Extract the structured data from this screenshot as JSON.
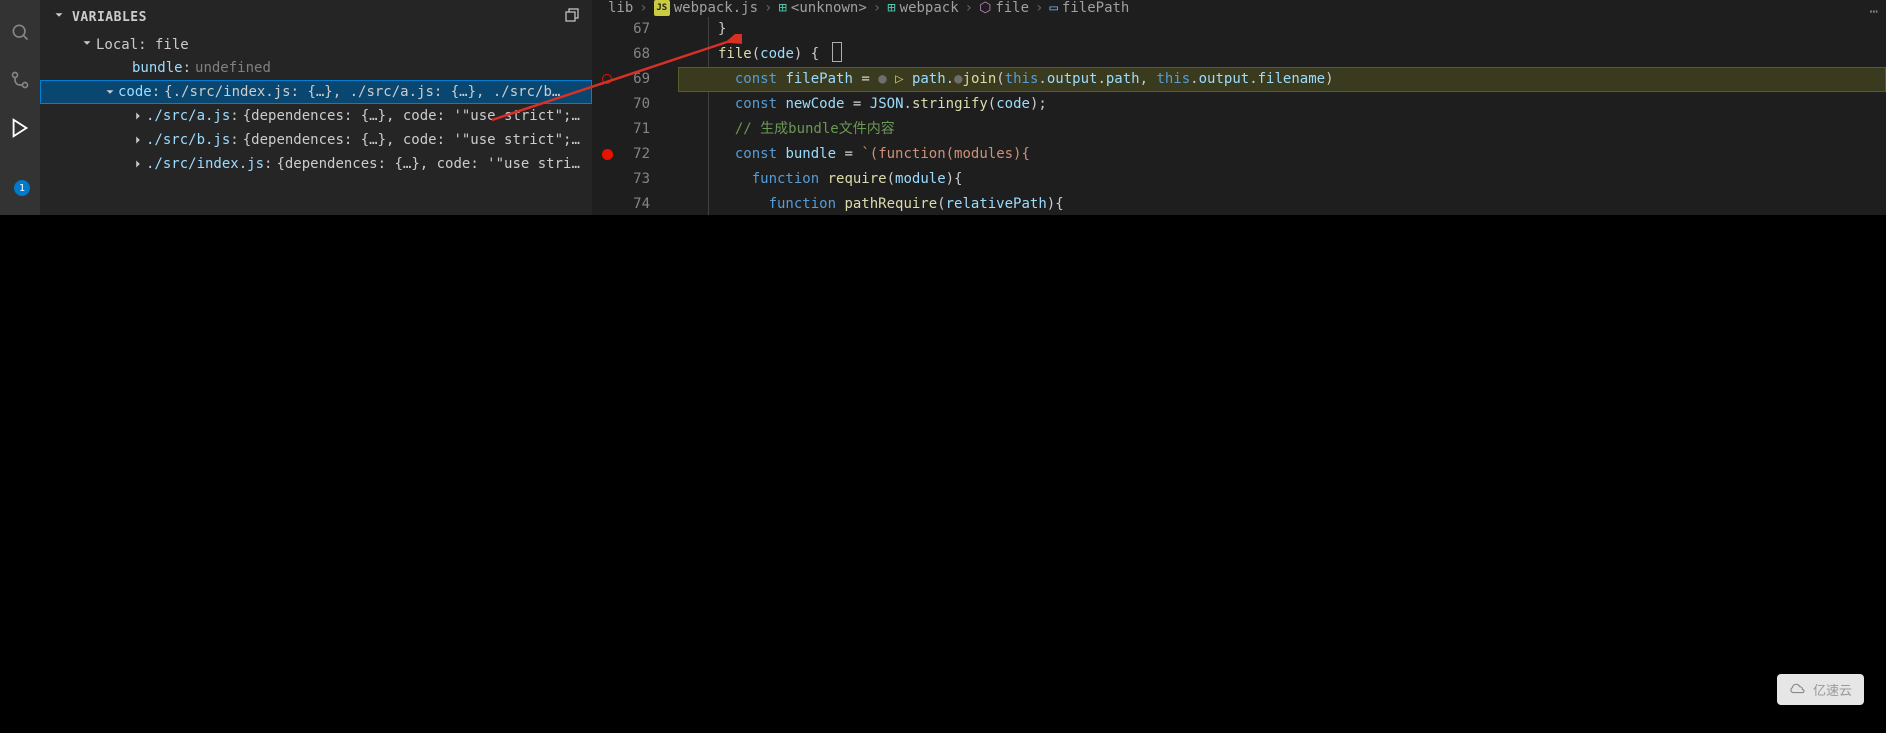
{
  "activity": {
    "badge": "1"
  },
  "variablesPanel": {
    "title": "VARIABLES",
    "scope": "Local: file",
    "bundle": {
      "name": "bundle",
      "value": "undefined"
    },
    "code": {
      "name": "code",
      "value": "{./src/index.js: {…}, ./src/a.js: {…}, ./src/b…"
    },
    "children": [
      {
        "name": "./src/a.js",
        "value": "{dependences: {…}, code: '\"use strict\";…"
      },
      {
        "name": "./src/b.js",
        "value": "{dependences: {…}, code: '\"use strict\";…"
      },
      {
        "name": "./src/index.js",
        "value": "{dependences: {…}, code: '\"use stri…"
      }
    ]
  },
  "breadcrumb": {
    "lib": "lib",
    "file": "webpack.js",
    "unknown": "<unknown>",
    "webpack": "webpack",
    "method": "file",
    "var": "filePath"
  },
  "code": {
    "lines": [
      {
        "num": "67",
        "raw": "    }"
      },
      {
        "num": "68",
        "raw": "    file(code) {",
        "cursor": true
      },
      {
        "num": "69",
        "raw": "      const filePath = • ▷ path.•join(this.output.path, this.output.filename)",
        "hl": true,
        "bpOutline": true
      },
      {
        "num": "70",
        "raw": "      const newCode = JSON.stringify(code);"
      },
      {
        "num": "71",
        "raw": "      // 生成bundle文件内容"
      },
      {
        "num": "72",
        "raw": "      const bundle = `(function(modules){",
        "bp": true
      },
      {
        "num": "73",
        "raw": "        function require(module){"
      },
      {
        "num": "74",
        "raw": "          function pathRequire(relativePath){"
      }
    ],
    "tokens": {
      "l68": {
        "fn": "file",
        "param": "code"
      },
      "l69": {
        "kw": "const",
        "vr": "filePath",
        "path": "path",
        "join": "join",
        "th": "this",
        "output": "output",
        "pathProp": "path",
        "filename": "filename"
      },
      "l70": {
        "kw": "const",
        "vr": "newCode",
        "json": "JSON",
        "stringify": "stringify",
        "code": "code"
      },
      "l71": {
        "comment": "// 生成bundle文件内容"
      },
      "l72": {
        "kw": "const",
        "vr": "bundle",
        "tmpl": "`(function(modules){"
      },
      "l73": {
        "kw": "function",
        "fn": "require",
        "param": "module"
      },
      "l74": {
        "kw": "function",
        "fn": "pathRequire",
        "param": "relativePath"
      }
    }
  },
  "watermark": "亿速云"
}
